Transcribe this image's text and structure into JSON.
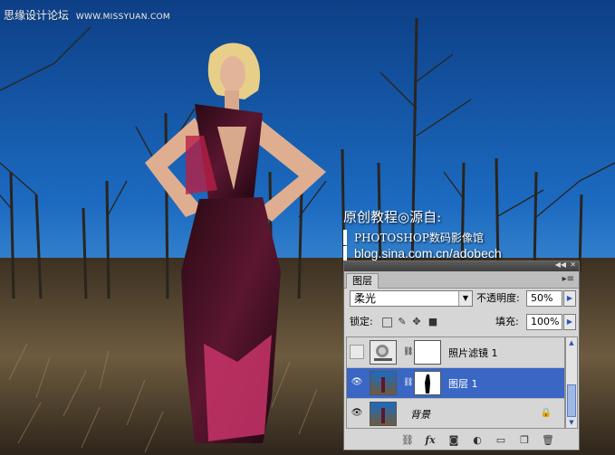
{
  "watermark": {
    "title": "思缘设计论坛",
    "site": "WWW.MISSYUAN.COM"
  },
  "credit": {
    "line1": "原创教程◎源自:",
    "line2": "PHOTOSHOP数码影像馆",
    "line3": "blog.sina.com.cn/adobech"
  },
  "panel": {
    "tab": "图层",
    "collapse_icon": "double-chevron-icon",
    "close_icon": "close-icon",
    "blend_mode": "柔光",
    "opacity_label": "不透明度:",
    "opacity_value": "50%",
    "lock_label": "锁定:",
    "fill_label": "填充:",
    "fill_value": "100%",
    "layers": [
      {
        "name": "照片滤镜 1",
        "visible": false,
        "type": "adjustment",
        "selected": false
      },
      {
        "name": "图层 1",
        "visible": true,
        "type": "pixel",
        "selected": true
      },
      {
        "name": "背景",
        "visible": true,
        "type": "background",
        "selected": false,
        "locked": true
      }
    ],
    "bottom_icons": [
      "link-layers-icon",
      "fx-icon",
      "add-mask-icon",
      "adjustment-layer-icon",
      "new-group-icon",
      "new-layer-icon",
      "trash-icon"
    ]
  }
}
